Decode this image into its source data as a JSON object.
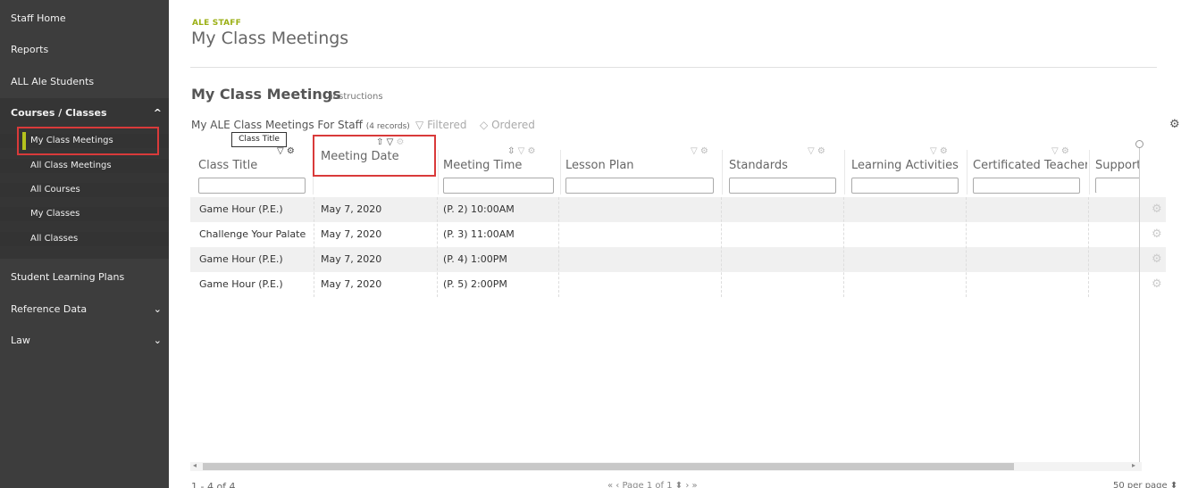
{
  "sidebar": {
    "items": [
      {
        "label": "Staff Home"
      },
      {
        "label": "Reports"
      },
      {
        "label": "ALL Ale Students"
      },
      {
        "label": "Courses / Classes"
      },
      {
        "label": "Student Learning Plans"
      },
      {
        "label": "Reference Data"
      },
      {
        "label": "Law"
      }
    ],
    "courses_sub": [
      {
        "label": "My Class Meetings"
      },
      {
        "label": "All Class Meetings"
      },
      {
        "label": "All Courses"
      },
      {
        "label": "My Classes"
      },
      {
        "label": "All Classes"
      }
    ],
    "chevron_up": "^",
    "chevron_down": "⌄"
  },
  "header": {
    "eyebrow": "ALE STAFF",
    "title": "My Class Meetings"
  },
  "section": {
    "title": "My Class Meetings",
    "instructions": "instructions",
    "subtitle": "My ALE Class Meetings For Staff",
    "records": "(4 records)",
    "filtered": "Filtered",
    "ordered": "Ordered"
  },
  "tooltip": "Class Title",
  "columns": [
    {
      "label": "Class Title"
    },
    {
      "label": "Meeting Date"
    },
    {
      "label": "Meeting Time"
    },
    {
      "label": "Lesson Plan"
    },
    {
      "label": "Standards"
    },
    {
      "label": "Learning Activities"
    },
    {
      "label": "Certificated Teacher"
    },
    {
      "label": "Support"
    }
  ],
  "rows": [
    {
      "class_title": "Game Hour (P.E.)",
      "meeting_date": "May 7, 2020",
      "meeting_time": "(P. 2) 10:00AM"
    },
    {
      "class_title": "Challenge Your Palate",
      "meeting_date": "May 7, 2020",
      "meeting_time": "(P. 3) 11:00AM"
    },
    {
      "class_title": "Game Hour (P.E.)",
      "meeting_date": "May 7, 2020",
      "meeting_time": "(P. 4) 1:00PM"
    },
    {
      "class_title": "Game Hour (P.E.)",
      "meeting_date": "May 7, 2020",
      "meeting_time": "(P. 5) 2:00PM"
    }
  ],
  "footer": {
    "range": "1 - 4 of 4",
    "pager": "«   ‹   Page 1 of 1 ⬍   ›   »",
    "per_page": "50 per page ⬍"
  },
  "colors": {
    "sidebar_bg": "#3d3d3d",
    "accent": "#9bb015",
    "highlight": "#d93a3a"
  }
}
